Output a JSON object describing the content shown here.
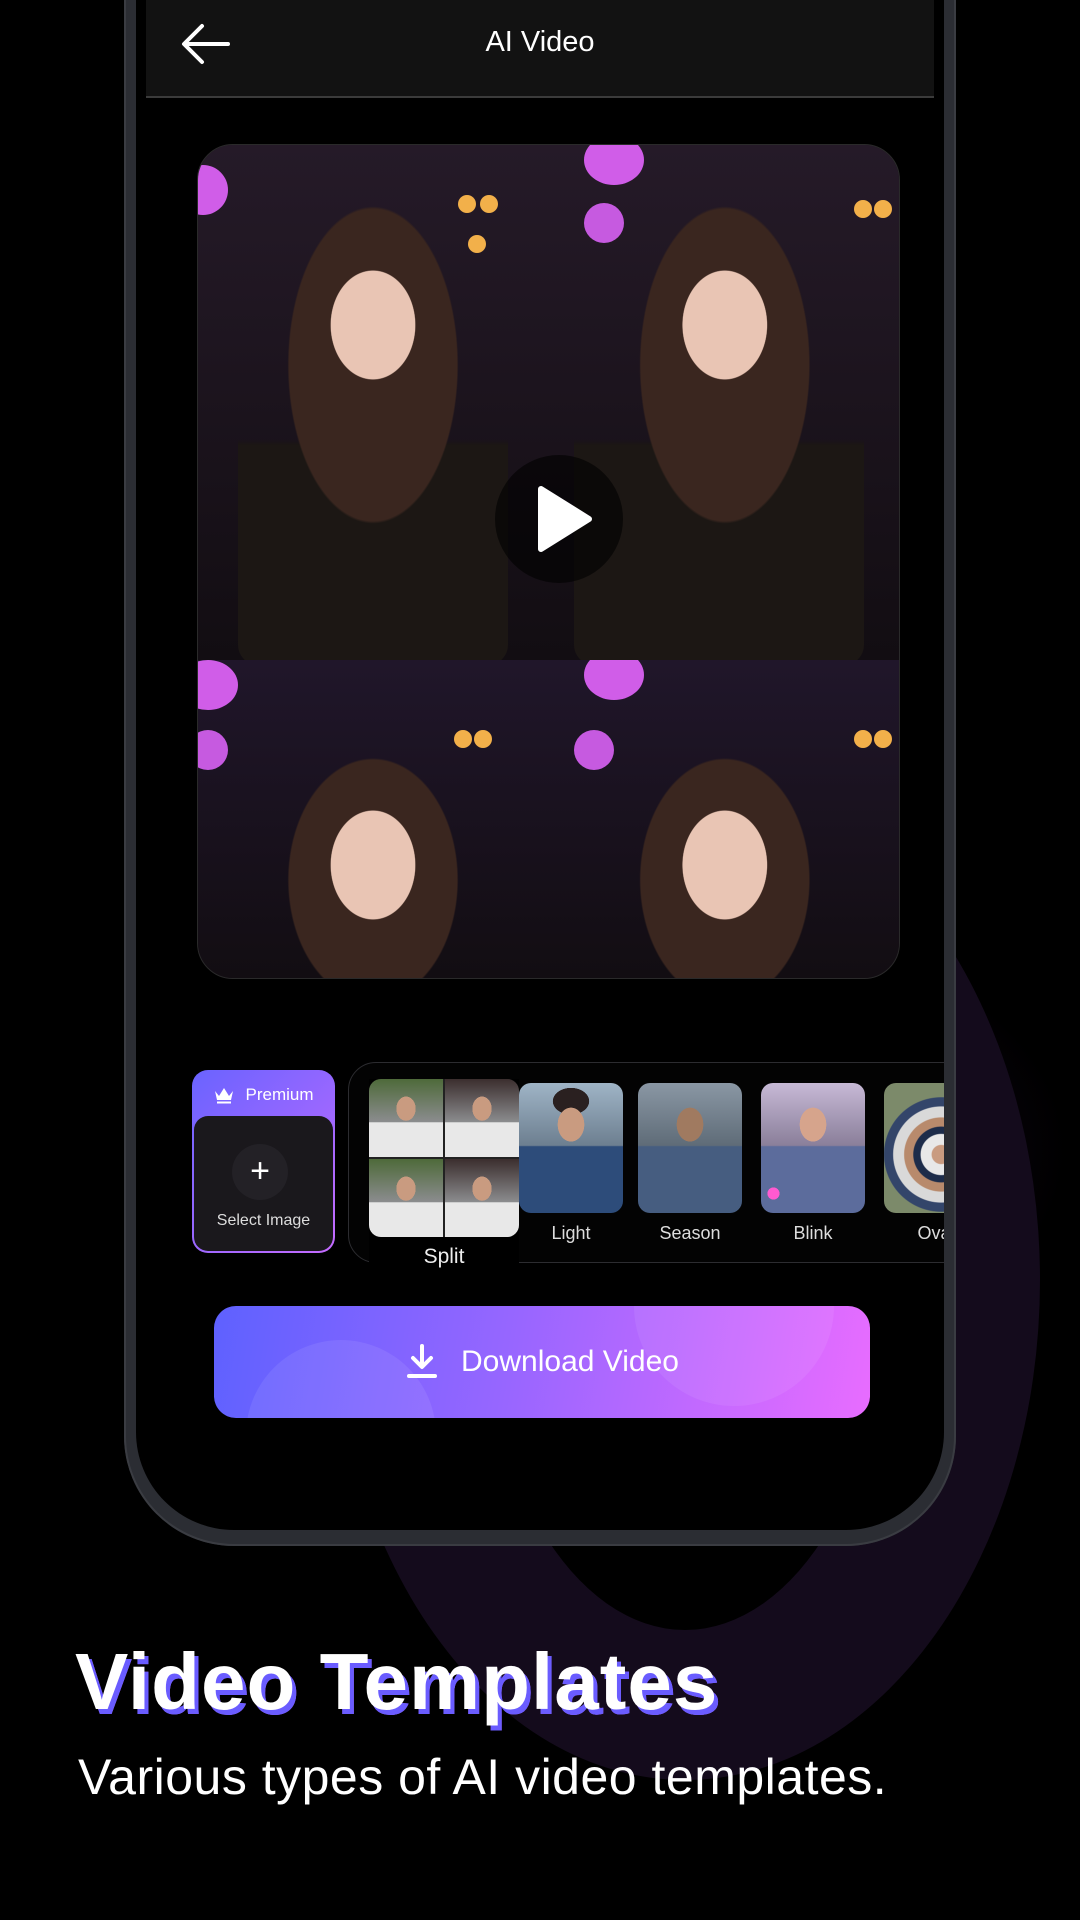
{
  "header": {
    "title": "AI Video",
    "back_icon": "arrow-left-icon"
  },
  "preview": {
    "play_icon": "play-icon",
    "tiles": 4
  },
  "premium": {
    "badge_label": "Premium",
    "badge_icon": "crown-icon",
    "add_icon": "plus-icon",
    "select_label": "Select Image"
  },
  "templates": [
    {
      "label": "Split",
      "selected": true
    },
    {
      "label": "Light",
      "selected": false
    },
    {
      "label": "Season",
      "selected": false
    },
    {
      "label": "Blink",
      "selected": false
    },
    {
      "label": "Oval",
      "selected": false
    }
  ],
  "download": {
    "label": "Download Video",
    "icon": "download-icon"
  },
  "promo": {
    "title": "Video Templates",
    "subtitle": "Various types of AI video templates."
  },
  "colors": {
    "gradient_start": "#5e61ff",
    "gradient_mid": "#9766ff",
    "gradient_end": "#e86cff",
    "background": "#000000"
  }
}
